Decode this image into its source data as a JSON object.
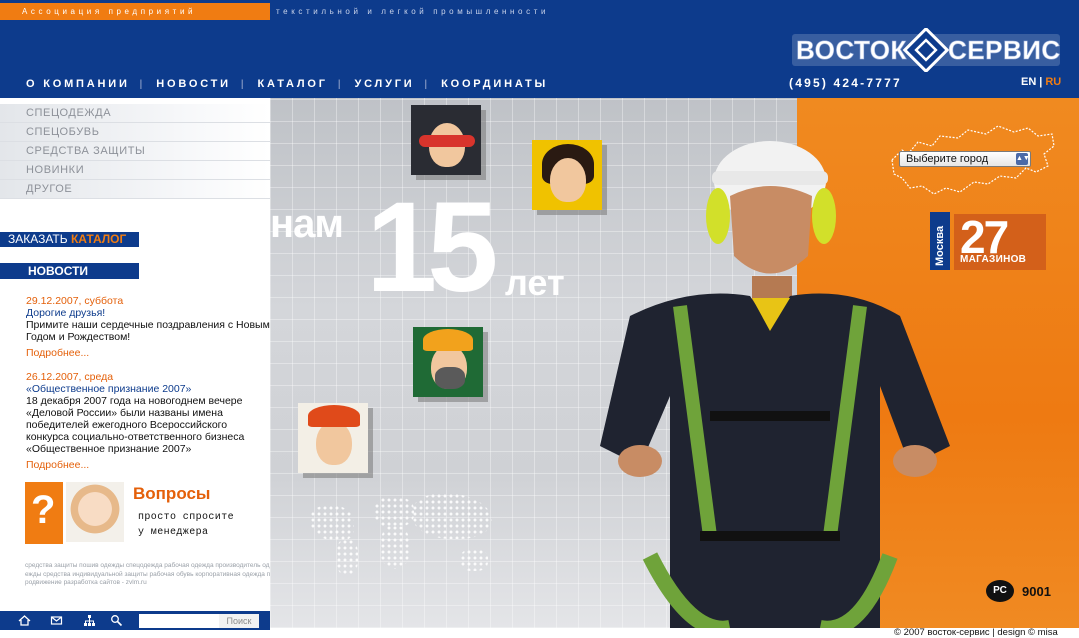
{
  "header": {
    "association_left": "Ассоциация предприятий",
    "association_right": "текстильной и легкой промышленности",
    "logo_text": "ВОСТОК-СЕРВИС",
    "nav": [
      "О КОМПАНИИ",
      "НОВОСТИ",
      "КАТАЛОГ",
      "УСЛУГИ",
      "КООРДИНАТЫ"
    ],
    "phone": "(495) 424-7777",
    "lang_en": "EN",
    "lang_sep": "|",
    "lang_ru": "RU"
  },
  "sidebar": {
    "categories": [
      "СПЕЦОДЕЖДА",
      "СПЕЦОБУВЬ",
      "СРЕДСТВА ЗАЩИТЫ",
      "НОВИНКИ",
      "ДРУГОЕ"
    ],
    "order_prefix": "ЗАКАЗАТЬ",
    "order_highlight": "КАТАЛОГ",
    "news_heading": "НОВОСТИ",
    "news": [
      {
        "date": "29.12.2007, суббота",
        "title": "Дорогие друзья!",
        "body": "Примите наши сердечные поздравления с Новым Годом и Рождеством!",
        "more": "Подробнее..."
      },
      {
        "date": "26.12.2007, среда",
        "title": "«Общественное признание 2007»",
        "body": "18 декабря 2007 года на новогоднем вечере «Деловой России» были названы имена победителей ежегодного Всероссийского конкурса социально-ответственного бизнеса «Общественное признание 2007»",
        "more": "Подробнее..."
      }
    ],
    "faq_mark": "?",
    "faq_title": "Вопросы",
    "faq_line1": "просто спросите",
    "faq_line2": "у менеджера",
    "tags": "средства защиты пошив одежды спецодежда рабочая одежда производитель одежды средства индивидуальной защиты рабочая обувь корпоративная одежда продвижение разработка сайтов - zvlm.ru",
    "search_placeholder": "",
    "search_button": "Поиск"
  },
  "hero": {
    "nam": "нам",
    "number": "15",
    "let": "лет",
    "city_select": "Выберите город",
    "stores_city": "Москва",
    "stores_count": "27",
    "stores_label": "МАГАЗИНОВ",
    "cert_mark": "РС",
    "cert_number": "9001"
  },
  "footer": {
    "copyright": "© 2007 восток-сервис | design © misa"
  },
  "colors": {
    "brand_blue": "#0d3b8c",
    "brand_orange": "#f07c12",
    "accent_red_orange": "#e4600a"
  },
  "icons": {
    "bottom_bar": [
      "home-icon",
      "mail-icon",
      "sitemap-icon",
      "search-icon"
    ]
  }
}
